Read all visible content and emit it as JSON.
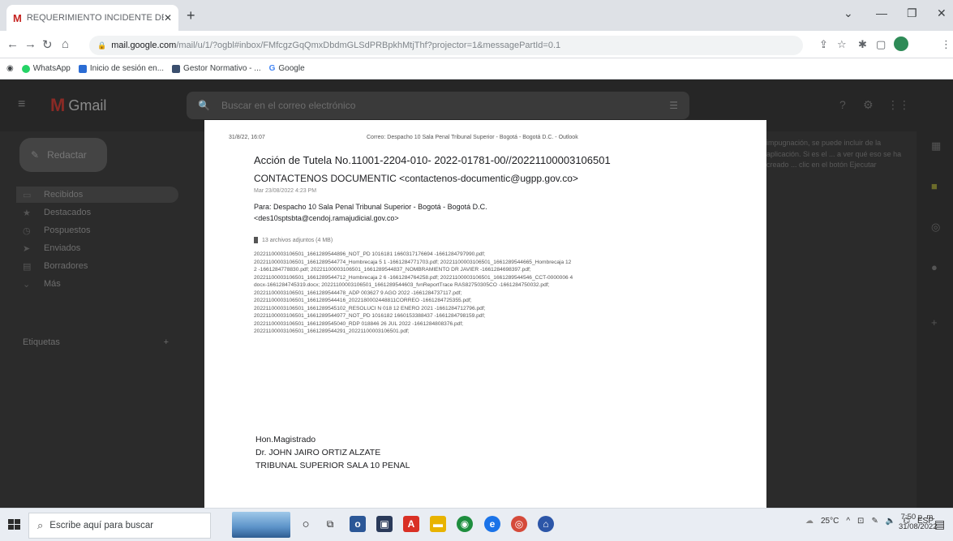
{
  "browser": {
    "tab_title": "REQUERIMIENTO INCIDENTE DE",
    "tab_icon": "M",
    "new_tab": "+",
    "url_host": "mail.google.com",
    "url_path": "/mail/u/1/?ogbl#inbox/FMfcgzGqQmxDbdmGLSdPRBpkhMtjThf?projector=1&messagePartId=0.1",
    "bookmarks": [
      "WhatsApp",
      "Inicio de sesión en...",
      "Gestor Normativo - ...",
      "Google"
    ]
  },
  "gmail": {
    "logo": "Gmail",
    "search_placeholder": "Buscar en el correo electrónico",
    "compose": "Redactar",
    "nav": [
      "Recibidos",
      "Destacados",
      "Pospuestos",
      "Enviados",
      "Borradores",
      "Más"
    ],
    "labels": "Etiquetas",
    "labels_add": "+",
    "right_snippet": "impugnación, se puede incluir de la aplicación. Si es el ... a ver qué eso se ha creado ... clic en el botón Ejecutar"
  },
  "document": {
    "print_date": "31/8/22, 16:07",
    "print_header": "Correo: Despacho 10 Sala Penal Tribunal Superior - Bogotá - Bogotá D.C. - Outlook",
    "subject": "Acción de Tutela No.11001-2204-010- 2022-01781-00//20221100003106501",
    "from": "CONTACTENOS DOCUMENTIC <contactenos-documentic@ugpp.gov.co>",
    "date": "Mar 23/08/2022 4:23 PM",
    "to_line1": "Para: Despacho 10 Sala Penal Tribunal Superior - Bogotá - Bogotá D.C.",
    "to_line2": "<des10sptsbta@cendoj.ramajudicial.gov.co>",
    "attachments_header": "13 archivos adjuntos (4 MB)",
    "attachments": [
      "20221100003106501_1661289544896_NOT_PD 1016181 1660317176694 -1661284797990.pdf;",
      "20221100003106501_1661289544774_Hombrecaja 5 1 -1661284771703.pdf; 20221100003106501_1661289544665_Hombrecaja 12",
      "2 -1661284778830.pdf; 20221100003106501_1661289544837_NOMBRAMIENTO DR JAVIER -1661284698397.pdf;",
      "20221100003106501_1661289544712_Hombrecaja 2 6 -1661284764258.pdf; 20221100003106501_1661289544546_CCT-0000006 4",
      "docx-1661284745319.docx; 20221100003106501_1661289544603_fvnReportTrace RAS82750305CO -1661284750032.pdf;",
      "20221100003106501_1661289544478_ADP 003627 9 AGO 2022 -1661284737117.pdf;",
      "20221100003106501_1661289544416_2022180002448811CORREO -1661284725355.pdf;",
      "20221100003106501_1661289545102_RESOLUCI N 018 12 ENERO 2021 -1661284712796.pdf;",
      "20221100003106501_1661289544977_NOT_PD 1016182 1660153388437 -1661284798159.pdf;",
      "20221100003106501_1661289545040_RDP 018846 26 JUL 2022 -1661284808376.pdf;",
      "20221100003106501_1661289544291_20221100003106501.pdf;"
    ],
    "sig_line1": "Hon.Magistrado",
    "sig_line2": "Dr. JOHN JAIRO ORTIZ ALZATE",
    "sig_line3": "TRIBUNAL SUPERIOR SALA 10 PENAL"
  },
  "taskbar": {
    "search_placeholder": "Escribe aquí para buscar",
    "temperature": "25°C",
    "lang": "ESP",
    "time": "7:50 p. m.",
    "date": "31/08/2022"
  }
}
